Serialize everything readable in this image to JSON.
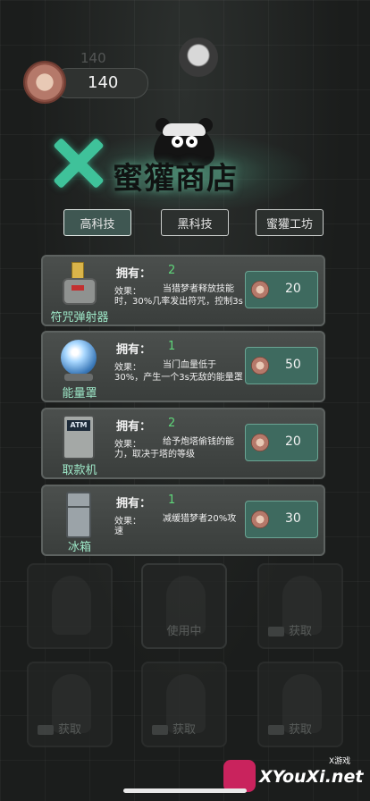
{
  "background": {
    "faint_number": "140"
  },
  "currency": {
    "count": "140",
    "icon": "badger-coin-icon"
  },
  "header": {
    "title": "蜜獾商店",
    "close_icon": "close-x-icon"
  },
  "tabs": [
    {
      "label": "高科技",
      "active": true
    },
    {
      "label": "黑科技",
      "active": false
    },
    {
      "label": "蜜獾工坊",
      "active": false
    }
  ],
  "items": [
    {
      "name": "符咒弹射器",
      "owned_label": "拥有：",
      "owned_value": "2",
      "effect_label": "效果：",
      "effect": "当猎梦者释放技能时，30%几率发出符咒，控制3s",
      "price": "20"
    },
    {
      "name": "能量罩",
      "owned_label": "拥有：",
      "owned_value": "1",
      "effect_label": "效果：",
      "effect": "当门血量低于30%，产生一个3s无敌的能量罩",
      "price": "50"
    },
    {
      "name": "取款机",
      "owned_label": "拥有：",
      "owned_value": "2",
      "effect_label": "效果：",
      "effect": "给予炮塔偷钱的能力，取决于塔的等级",
      "price": "20",
      "icon_text": "ATM"
    },
    {
      "name": "冰箱",
      "owned_label": "拥有：",
      "owned_value": "1",
      "effect_label": "效果：",
      "effect": "减缓猎梦者20%攻速",
      "price": "30"
    }
  ],
  "characters": [
    {
      "caption": ""
    },
    {
      "caption": "使用中"
    },
    {
      "caption": "获取"
    },
    {
      "caption": "获取"
    },
    {
      "caption": "获取"
    },
    {
      "caption": "获取"
    }
  ],
  "watermark": {
    "text": "XYouXi.net",
    "small": "X游戏"
  },
  "colors": {
    "accent": "#3fc29a",
    "button": "#3e6a5f",
    "owned": "#5fd67a"
  }
}
